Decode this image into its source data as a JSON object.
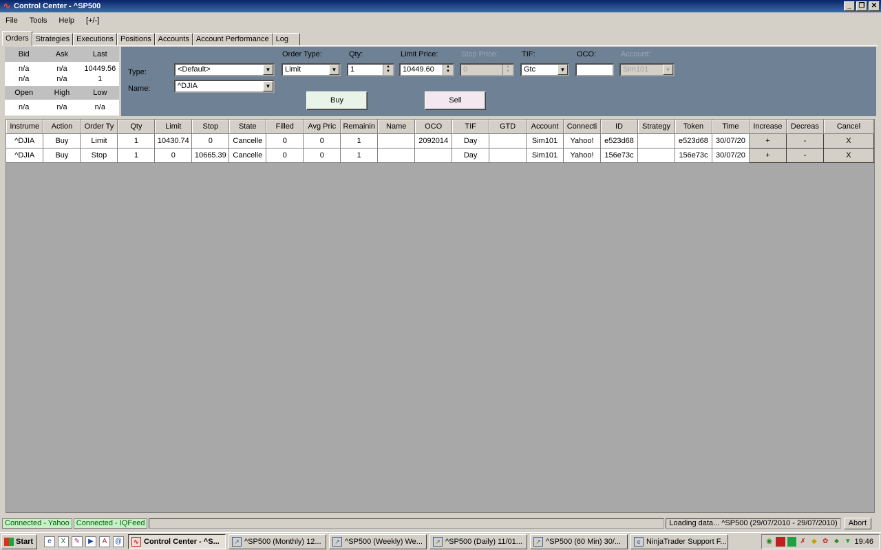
{
  "window": {
    "title": "Control Center - ^SP500"
  },
  "menu": [
    "File",
    "Tools",
    "Help",
    "[+/-]"
  ],
  "tabs": [
    "Orders",
    "Strategies",
    "Executions",
    "Positions",
    "Accounts",
    "Account Performance",
    "Log"
  ],
  "quote": {
    "head1": [
      "Bid",
      "Ask",
      "Last"
    ],
    "row1": [
      "n/a",
      "n/a",
      "10449.56"
    ],
    "row2": [
      "n/a",
      "n/a",
      "1"
    ],
    "head2": [
      "Open",
      "High",
      "Low"
    ],
    "row3": [
      "n/a",
      "n/a",
      "n/a"
    ]
  },
  "entry": {
    "type_label": "Type:",
    "type_value": "<Default>",
    "name_label": "Name:",
    "name_value": "^DJIA",
    "order_type_label": "Order Type:",
    "order_type_value": "Limit",
    "qty_label": "Qty:",
    "qty_value": "1",
    "limit_label": "Limit Price:",
    "limit_value": "10449.60",
    "stop_label": "Stop Price:",
    "stop_value": "0",
    "tif_label": "TIF:",
    "tif_value": "Gtc",
    "oco_label": "OCO:",
    "oco_value": "",
    "account_label": "Account:",
    "account_value": "Sim101",
    "buy_label": "Buy",
    "sell_label": "Sell"
  },
  "grid": {
    "columns": [
      "Instrume",
      "Action",
      "Order Ty",
      "Qty",
      "Limit",
      "Stop",
      "State",
      "Filled",
      "Avg Pric",
      "Remainin",
      "Name",
      "OCO",
      "TIF",
      "GTD",
      "Account",
      "Connecti",
      "ID",
      "Strategy",
      "Token",
      "Time",
      "Increase",
      "Decreas",
      "Cancel"
    ],
    "rows": [
      [
        "^DJIA",
        "Buy",
        "Limit",
        "1",
        "10430.74",
        "0",
        "Cancelle",
        "0",
        "0",
        "1",
        "",
        "2092014",
        "Day",
        "",
        "Sim101",
        "Yahoo!",
        "e523d68",
        "",
        "e523d68",
        "30/07/20",
        "+",
        "-",
        "X"
      ],
      [
        "^DJIA",
        "Buy",
        "Stop",
        "1",
        "0",
        "10665.39",
        "Cancelle",
        "0",
        "0",
        "1",
        "",
        "",
        "Day",
        "",
        "Sim101",
        "Yahoo!",
        "156e73c",
        "",
        "156e73c",
        "30/07/20",
        "+",
        "-",
        "X"
      ]
    ]
  },
  "status": {
    "conn1": "Connected - Yahoo",
    "conn2": "Connected - IQFeed",
    "loading": "Loading data... ^SP500  (29/07/2010 - 29/07/2010)",
    "abort": "Abort"
  },
  "taskbar": {
    "start": "Start",
    "buttons": [
      "Control Center - ^S...",
      "^SP500 (Monthly)  12...",
      "^SP500 (Weekly)  We...",
      "^SP500 (Daily)  11/01...",
      "^SP500 (60 Min)  30/...",
      "NinjaTrader Support F..."
    ],
    "clock": "19:46"
  },
  "colors": {
    "entry_panel": "#6f8295",
    "buy": "#e8f4e8",
    "sell": "#f4e8f0",
    "grid_bg": "#a8a8a8"
  }
}
